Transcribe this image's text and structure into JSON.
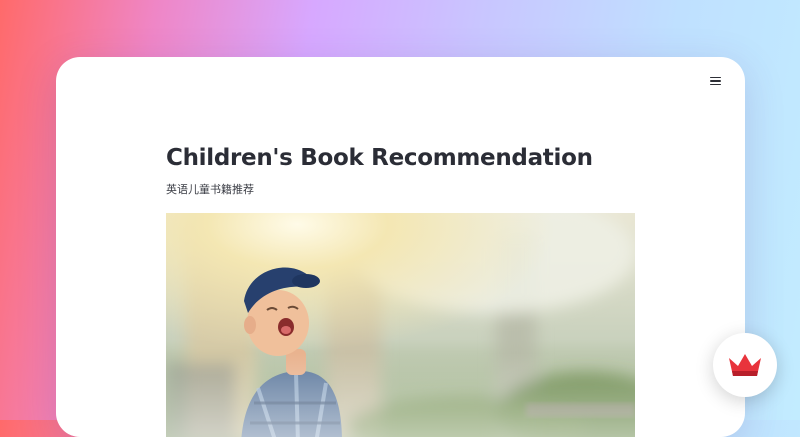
{
  "header": {
    "menu_icon": "hamburger-menu-icon"
  },
  "article": {
    "title": "Children's Book Recommendation",
    "subtitle": "英语儿童书籍推荐",
    "hero_image": "laughing-boy-in-cap-photo"
  },
  "widget": {
    "icon": "red-crown-icon",
    "accent_color": "#e8343c"
  },
  "colors": {
    "title_text": "#2b2d36",
    "card_background": "#ffffff"
  }
}
